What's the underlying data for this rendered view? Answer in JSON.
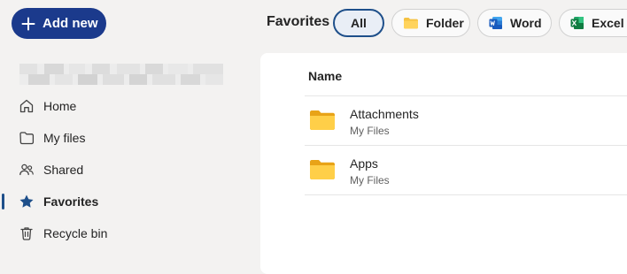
{
  "actions": {
    "add_new_label": "Add new"
  },
  "header": {
    "title": "Favorites",
    "filters": [
      {
        "label": "All",
        "icon": "none",
        "selected": true
      },
      {
        "label": "Folder",
        "icon": "folder-icon"
      },
      {
        "label": "Word",
        "icon": "word-icon"
      },
      {
        "label": "Excel",
        "icon": "excel-icon"
      }
    ]
  },
  "sidebar": {
    "items": [
      {
        "label": "Home",
        "icon": "home-icon"
      },
      {
        "label": "My files",
        "icon": "folder-outline-icon"
      },
      {
        "label": "Shared",
        "icon": "people-icon"
      },
      {
        "label": "Favorites",
        "icon": "star-icon",
        "active": true
      },
      {
        "label": "Recycle bin",
        "icon": "trash-icon"
      }
    ]
  },
  "list": {
    "column_name": "Name",
    "rows": [
      {
        "name": "Attachments",
        "location": "My Files",
        "icon": "folder-icon"
      },
      {
        "name": "Apps",
        "location": "My Files",
        "icon": "folder-icon"
      }
    ]
  },
  "colors": {
    "accent": "#1b3a8c",
    "selected_border": "#1e4f8a",
    "folder": "#f5c242",
    "word": "#185abd",
    "excel": "#107c41"
  }
}
